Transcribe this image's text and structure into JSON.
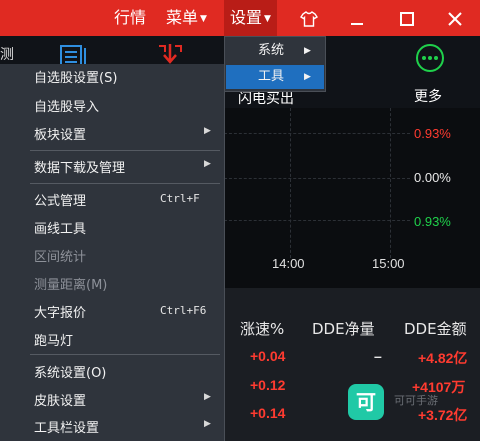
{
  "titlebar": {
    "hangqing": "行情",
    "menu": "菜单",
    "settings": "设置"
  },
  "toolbar": {
    "left_cut": "测",
    "partial_label": "闪电买出",
    "more_label": "更多"
  },
  "colors": {
    "accent": "#e02a22",
    "menu_bg": "#2f343c",
    "highlight": "#1f6fbf",
    "up": "#ff3b30",
    "down": "#1fd14b"
  },
  "menu": {
    "items": [
      {
        "label": "自选股设置(S)"
      },
      {
        "label": "自选股导入"
      },
      {
        "label": "板块设置"
      },
      {
        "label": "数据下载及管理"
      },
      {
        "label": "公式管理",
        "shortcut": "Ctrl+F"
      },
      {
        "label": "画线工具"
      },
      {
        "label": "区间统计"
      },
      {
        "label": "测量距离(M)"
      },
      {
        "label": "大字报价",
        "shortcut": "Ctrl+F6"
      },
      {
        "label": "跑马灯"
      },
      {
        "label": "系统设置(O)"
      },
      {
        "label": "皮肤设置"
      },
      {
        "label": "工具栏设置"
      }
    ]
  },
  "submenu": {
    "items": [
      {
        "label": "系统"
      },
      {
        "label": "工具"
      }
    ]
  },
  "chart": {
    "pct_top": "0.93%",
    "pct_mid": "0.00%",
    "pct_bot": "0.93%",
    "time1": "14:00",
    "time2": "15:00"
  },
  "table": {
    "headers": [
      "涨速%",
      "DDE净量",
      "DDE金额"
    ],
    "rows": [
      [
        "+0.04",
        "–",
        "+4.82亿"
      ],
      [
        "+0.12",
        "",
        "+4107万"
      ],
      [
        "+0.14",
        "",
        "+3.72亿"
      ]
    ]
  },
  "watermark": {
    "icon": "可",
    "text": "可可手游"
  }
}
